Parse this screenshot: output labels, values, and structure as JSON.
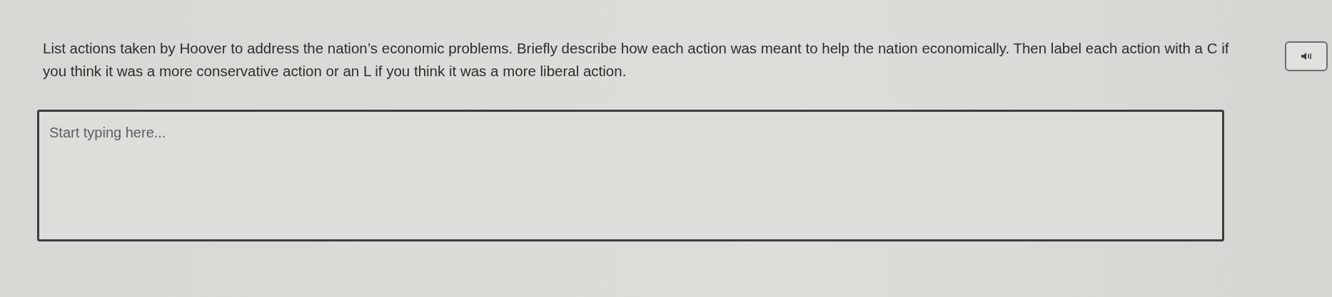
{
  "question": {
    "prompt": "List actions taken by Hoover to address the nation’s economic problems. Briefly describe how each action was meant to help the nation economically. Then label each action with a C if you think it was a more conservative action or an L if you think it was a more liberal action."
  },
  "answer": {
    "placeholder": "Start typing here..."
  }
}
